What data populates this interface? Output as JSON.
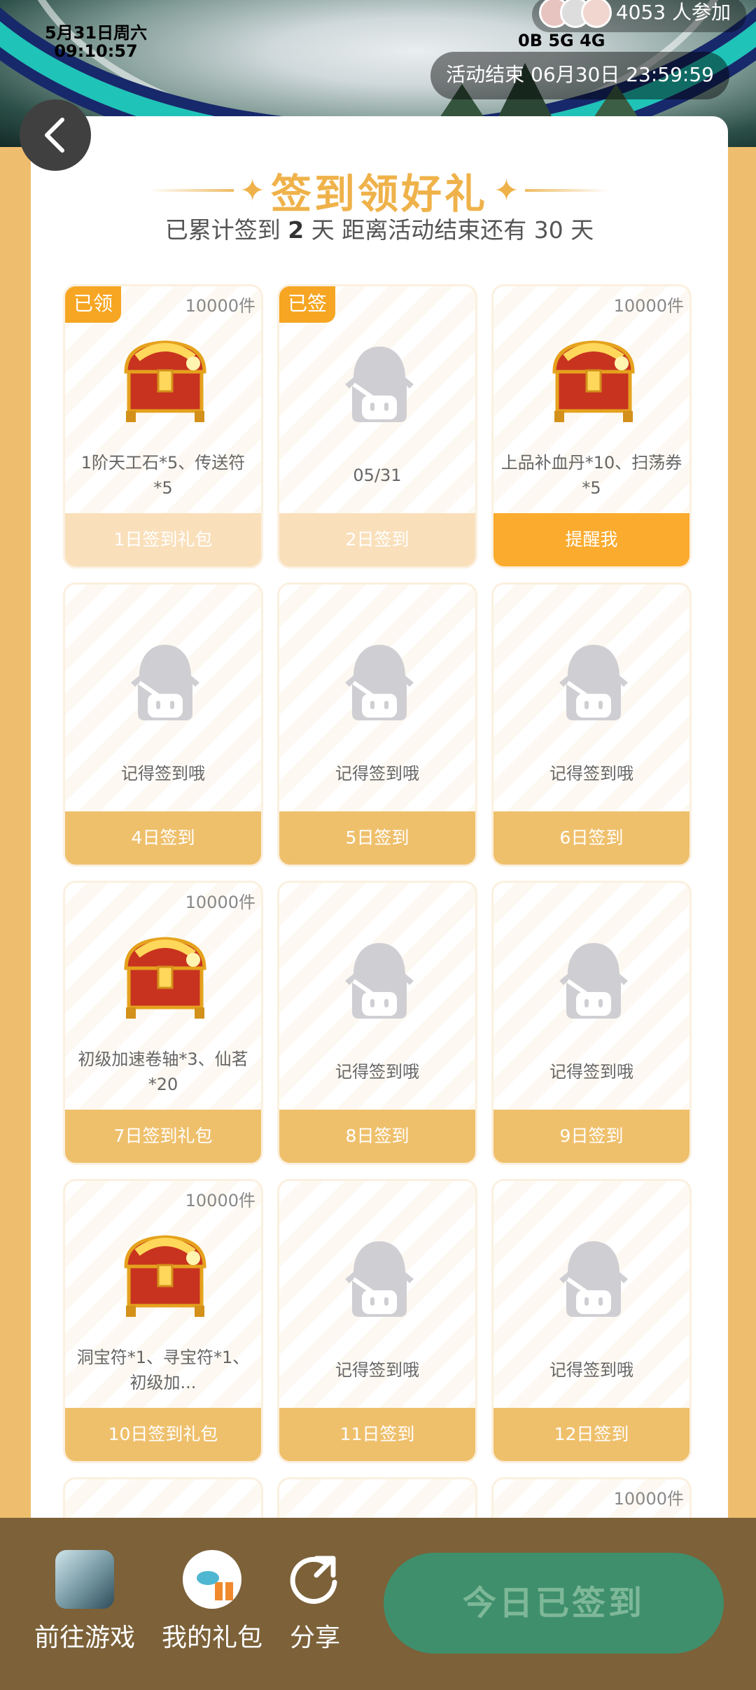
{
  "status": {
    "date": "5月31日周六",
    "time": "09:10:57",
    "signal": "0B 5G 4G"
  },
  "banner": {
    "participants": "4053 人参加",
    "end_label": "活动结束 06月30日 23:59:59"
  },
  "header": {
    "title": "签到领好礼",
    "sub_prefix": "已累计签到",
    "sub_days": "2",
    "sub_mid": "天  距离活动结束还有 30 天"
  },
  "tiles": [
    {
      "badge": "已领",
      "count": "10000件",
      "desc": "1阶天工石*5、传送符*5",
      "button": "1日签到礼包"
    },
    {
      "badge": "已签",
      "count": "",
      "desc": "05/31",
      "button": "2日签到"
    },
    {
      "badge": "",
      "count": "10000件",
      "desc": "上品补血丹*10、扫荡券*5",
      "button": "提醒我"
    },
    {
      "badge": "",
      "count": "",
      "desc": "记得签到哦",
      "button": "4日签到"
    },
    {
      "badge": "",
      "count": "",
      "desc": "记得签到哦",
      "button": "5日签到"
    },
    {
      "badge": "",
      "count": "",
      "desc": "记得签到哦",
      "button": "6日签到"
    },
    {
      "badge": "",
      "count": "10000件",
      "desc": "初级加速卷轴*3、仙茗*20",
      "button": "7日签到礼包"
    },
    {
      "badge": "",
      "count": "",
      "desc": "记得签到哦",
      "button": "8日签到"
    },
    {
      "badge": "",
      "count": "",
      "desc": "记得签到哦",
      "button": "9日签到"
    },
    {
      "badge": "",
      "count": "10000件",
      "desc": "洞宝符*1、寻宝符*1、初级加...",
      "button": "10日签到礼包"
    },
    {
      "badge": "",
      "count": "",
      "desc": "记得签到哦",
      "button": "11日签到"
    },
    {
      "badge": "",
      "count": "",
      "desc": "记得签到哦",
      "button": "12日签到"
    },
    {
      "badge": "",
      "count": "",
      "desc": "",
      "button": ""
    },
    {
      "badge": "",
      "count": "",
      "desc": "",
      "button": ""
    },
    {
      "badge": "",
      "count": "10000件",
      "desc": "",
      "button": ""
    }
  ],
  "bottom": {
    "go_game": "前往游戏",
    "my_gifts": "我的礼包",
    "share": "分享",
    "signed_today": "今日已签到"
  },
  "colors": {
    "accent": "#efb24a",
    "button": "#efc06c",
    "highlight": "#fbab2e",
    "signed": "#3f8f6c"
  }
}
